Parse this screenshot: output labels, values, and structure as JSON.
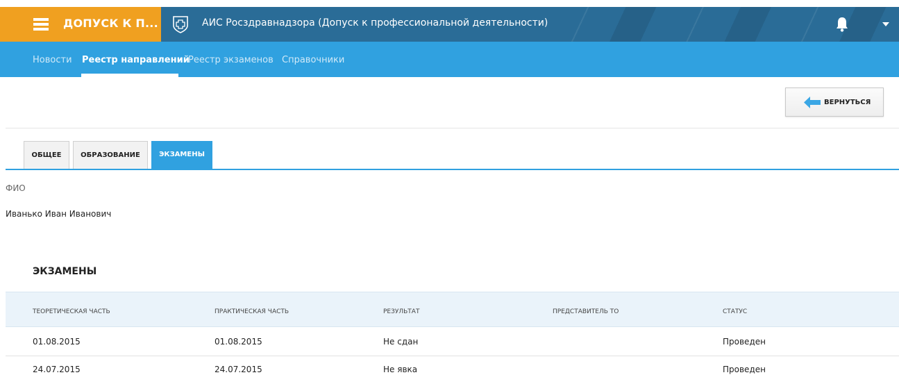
{
  "header": {
    "brand_title": "ДОПУСК К П...",
    "app_title": "АИС Росздравнадзора (Допуск к профессиональной деятельности)",
    "brand_color": "#f0a020",
    "bar_color": "#2a6c97"
  },
  "nav": {
    "items": [
      {
        "label": "Новости"
      },
      {
        "label": "Реестр направлений"
      },
      {
        "label": "Реестр экзаменов"
      },
      {
        "label": "Справочники"
      }
    ],
    "active_index": 1,
    "color": "#30a1e0"
  },
  "toolbar": {
    "back_label": "ВЕРНУТЬСЯ"
  },
  "tabs": [
    {
      "label": "ОБЩЕЕ"
    },
    {
      "label": "ОБРАЗОВАНИЕ"
    },
    {
      "label": "ЭКЗАМЕНЫ"
    }
  ],
  "person": {
    "fio_label": "ФИО",
    "fio_value": "Иванько Иван Иванович"
  },
  "exams": {
    "title": "ЭКЗАМЕНЫ",
    "columns": [
      "ТЕОРЕТИЧЕСКАЯ ЧАСТЬ",
      "ПРАКТИЧЕСКАЯ ЧАСТЬ",
      "РЕЗУЛЬТАТ",
      "ПРЕДСТАВИТЕЛЬ ТО",
      "СТАТУС"
    ],
    "rows": [
      [
        "01.08.2015",
        "01.08.2015",
        "Не сдан",
        "",
        "Проведен"
      ],
      [
        "24.07.2015",
        "24.07.2015",
        "Не явка",
        "",
        "Проведен"
      ]
    ]
  },
  "icons": {
    "menu": "hamburger-icon",
    "logo": "cross-shield-icon",
    "bell": "bell-icon",
    "caret": "caret-down-icon",
    "back": "arrow-left-icon"
  }
}
